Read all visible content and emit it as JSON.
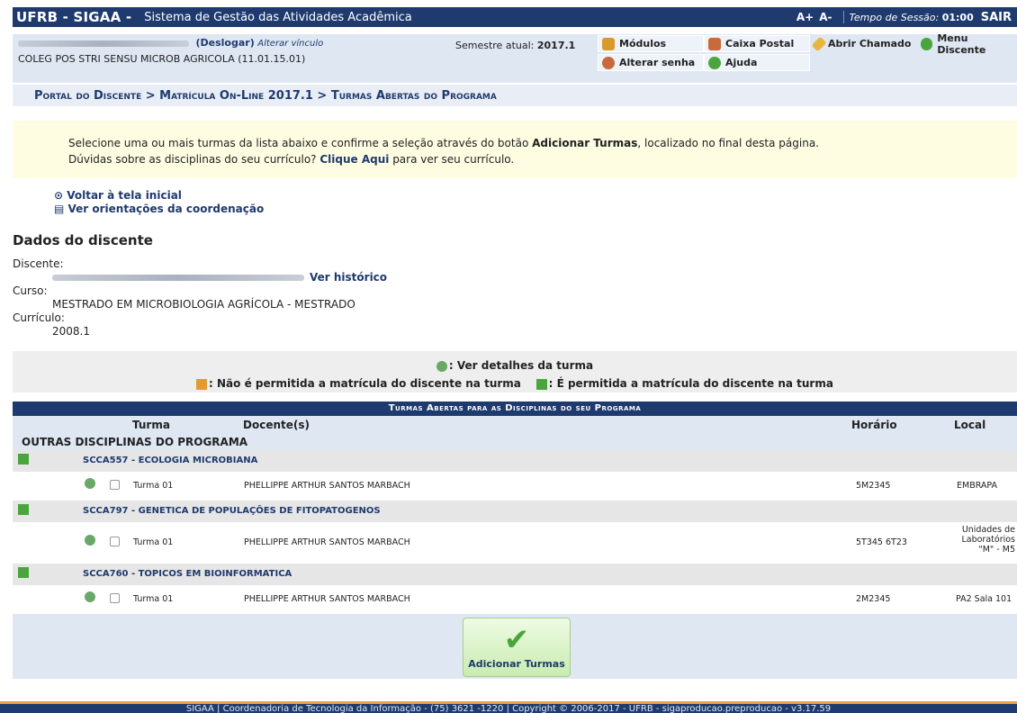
{
  "topbar": {
    "brand": "UFRB - SIGAA -",
    "system_name": "Sistema de Gestão das Atividades Acadêmica",
    "font_increase": "A+",
    "font_decrease": "A-",
    "session_label": "Tempo de Sessão:",
    "session_time": "01:00",
    "logout": "SAIR"
  },
  "userbar": {
    "deslogar": "(Deslogar)",
    "alterar_vinculo": "Alterar vínculo",
    "unit": "COLEG POS STRI SENSU MICROB AGRICOLA (11.01.15.01)",
    "semestre_label": "Semestre atual:",
    "semestre_value": "2017.1",
    "menu": {
      "modulos": "Módulos",
      "caixa_postal": "Caixa Postal",
      "abrir_chamado": "Abrir Chamado",
      "menu_discente": "Menu Discente",
      "alterar_senha": "Alterar senha",
      "ajuda": "Ajuda"
    }
  },
  "breadcrumb": "Portal do Discente > Matrícula On-Line 2017.1 > Turmas Abertas do Programa",
  "instructions": {
    "line1_pre": "Selecione uma ou mais turmas da lista abaixo e confirme a seleção através do botão ",
    "line1_bold": "Adicionar Turmas",
    "line1_post": ", localizado no final desta página.",
    "line2_pre": "Dúvidas sobre as disciplinas do seu currículo? ",
    "line2_link": "Clique Aqui",
    "line2_post": " para ver seu currículo."
  },
  "actions": {
    "voltar": "Voltar à tela inicial",
    "orientacoes": "Ver orientações da coordenação"
  },
  "dados": {
    "title": "Dados do discente",
    "discente_label": "Discente:",
    "ver_historico": "Ver histórico",
    "curso_label": "Curso:",
    "curso_value": "MESTRADO EM MICROBIOLOGIA AGRÍCOLA - MESTRADO",
    "curriculo_label": "Currículo:",
    "curriculo_value": "2008.1"
  },
  "legend": {
    "detalhes": ": Ver detalhes da turma",
    "nao_permitida": ": Não é permitida a matrícula do discente na turma",
    "permitida": ": É permitida a matrícula do discente na turma"
  },
  "table": {
    "caption": "Turmas Abertas para as Disciplinas do seu Programa",
    "headers": {
      "turma": "Turma",
      "docente": "Docente(s)",
      "horario": "Horário",
      "local": "Local"
    },
    "group": "OUTRAS DISCIPLINAS DO PROGRAMA",
    "disciplinas": [
      {
        "label": "SCCA557 - ECOLOGIA MICROBIANA",
        "turma": "Turma 01",
        "docente": "PHELLIPPE ARTHUR SANTOS MARBACH",
        "horario": "5M2345",
        "local": "EMBRAPA"
      },
      {
        "label": "SCCA797 - GENETICA DE POPULAÇÕES DE FITOPATOGENOS",
        "turma": "Turma 01",
        "docente": "PHELLIPPE ARTHUR SANTOS MARBACH",
        "horario": "5T345 6T23",
        "local": "Unidades de Laboratórios \"M\" - M5"
      },
      {
        "label": "SCCA760 - TOPICOS EM BIOINFORMATICA",
        "turma": "Turma 01",
        "docente": "PHELLIPPE ARTHUR SANTOS MARBACH",
        "horario": "2M2345",
        "local": "PA2 Sala 101"
      }
    ],
    "submit": "Adicionar Turmas"
  },
  "footer": "SIGAA | Coordenadoria de Tecnologia da Informação - (75) 3621 -1220 | Copyright © 2006-2017 - UFRB - sigaproducao.preproducao - v3.17.59"
}
